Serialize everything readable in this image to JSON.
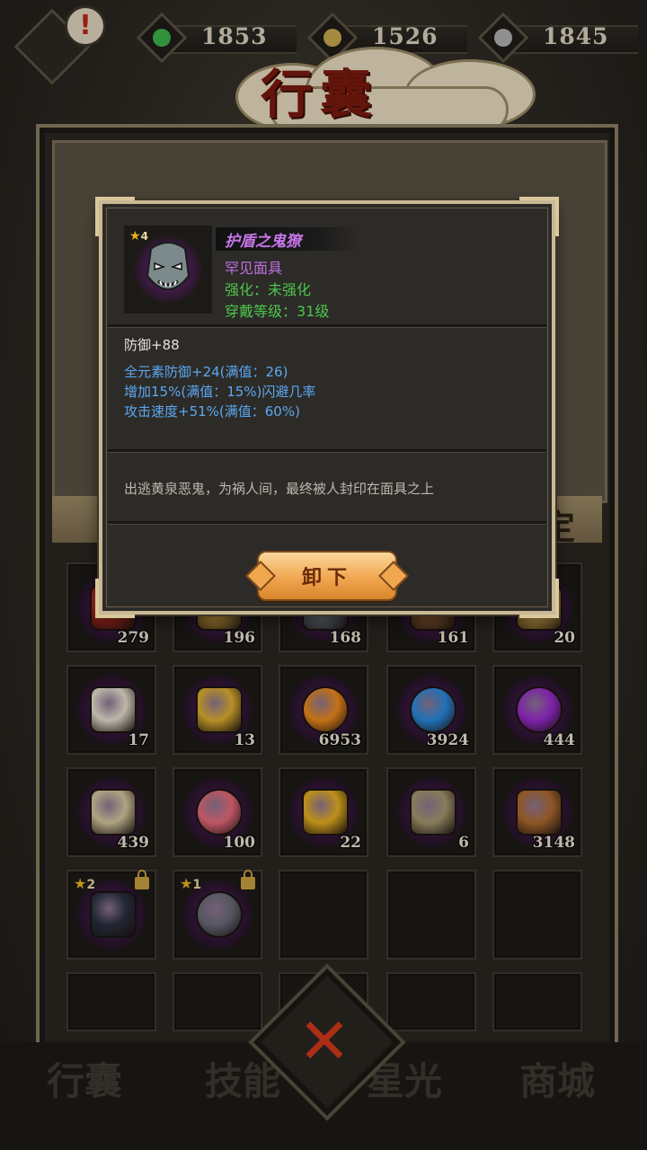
{
  "currencies": [
    {
      "name": "jade-currency",
      "value": "1853",
      "color": "#3bb34a"
    },
    {
      "name": "coin-currency",
      "value": "1526",
      "color": "#c8a850"
    },
    {
      "name": "spirit-currency",
      "value": "1845",
      "color": "#b0b0b0"
    }
  ],
  "title": "行囊",
  "alert_mark": "!",
  "banner_right": "定",
  "popup": {
    "star_count": "4",
    "name": "护盾之鬼獠",
    "rarity": "罕见面具",
    "enhance": "强化：未强化",
    "equip_level": "穿戴等级：31级",
    "base_stat": "防御+88",
    "sub_stats": [
      "全元素防御+24(满值：26)",
      "增加15%(满值：15%)闪避几率",
      "攻击速度+51%(满值：60%)"
    ],
    "description": "出逃黄泉恶鬼，为祸人间，最终被人封印在面具之上",
    "unequip_label": "卸下"
  },
  "inventory": [
    {
      "icon": "red-armor-icon",
      "qty": "279"
    },
    {
      "icon": "gold-tablet-icon",
      "qty": "196"
    },
    {
      "icon": "steel-mask-icon",
      "qty": "168"
    },
    {
      "icon": "bronze-item-icon",
      "qty": "161"
    },
    {
      "icon": "scroll-bundle-icon",
      "qty": "20"
    },
    {
      "icon": "crane-charm-icon",
      "qty": "17"
    },
    {
      "icon": "gold-badge-icon",
      "qty": "13"
    },
    {
      "icon": "orange-orb-icon",
      "qty": "6953"
    },
    {
      "icon": "blue-gem-icon",
      "qty": "3924"
    },
    {
      "icon": "purple-orb-icon",
      "qty": "444"
    },
    {
      "icon": "rice-sack-icon",
      "qty": "439"
    },
    {
      "icon": "peach-icon",
      "qty": "100"
    },
    {
      "icon": "talisman-scroll-icon",
      "qty": "22"
    },
    {
      "icon": "fish-icon",
      "qty": "6"
    },
    {
      "icon": "wooden-bucket-icon",
      "qty": "3148"
    },
    {
      "icon": "feather-mask-icon",
      "stars": "2",
      "locked": true
    },
    {
      "icon": "ring-icon",
      "stars": "1",
      "locked": true
    }
  ],
  "nav": [
    "行囊",
    "技能",
    "星光",
    "商城"
  ]
}
